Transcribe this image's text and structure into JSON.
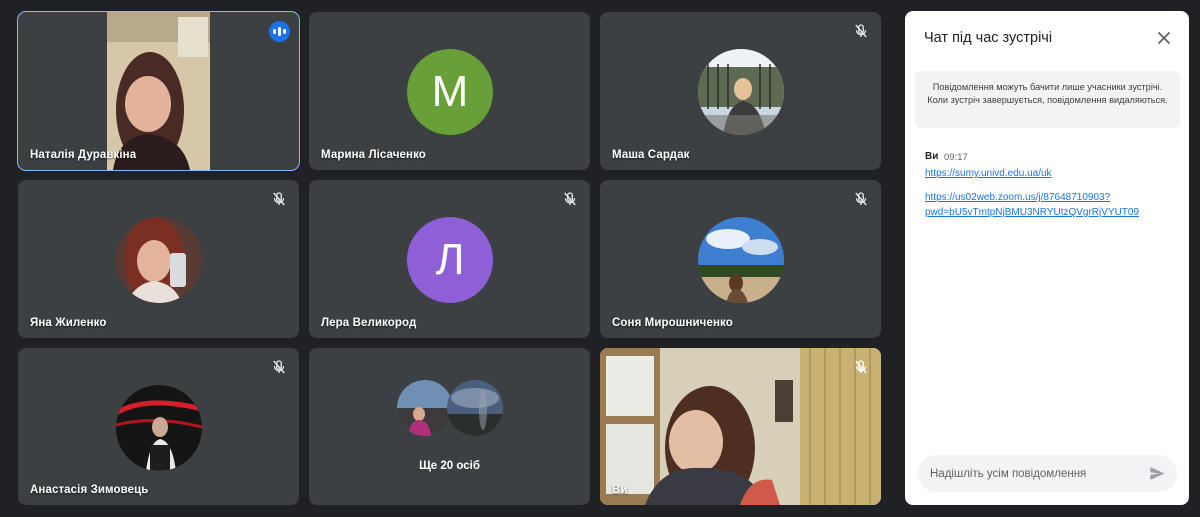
{
  "participants": [
    {
      "name": "Наталія Дуравкіна"
    },
    {
      "name": "Марина Лісаченко",
      "initial": "М",
      "color": "#689f38"
    },
    {
      "name": "Маша Сардак"
    },
    {
      "name": "Яна Жиленко"
    },
    {
      "name": "Лера Великород",
      "initial": "Л",
      "color": "#8e5fd6"
    },
    {
      "name": "Соня Мирошниченко"
    },
    {
      "name": "Анастасія Зимовець"
    },
    {
      "name": "Ще 20 осіб"
    },
    {
      "name": "Ви"
    }
  ],
  "chat": {
    "title": "Чат під час зустрічі",
    "notice": "Повідомлення можуть бачити лише учасники зустрічі. Коли зустріч завершується, повідомлення видаляються.",
    "message": {
      "sender": "Ви",
      "time": "09:17",
      "links": [
        "https://sumy.univd.edu.ua/uk",
        "https://us02web.zoom.us/j/87648710903?",
        "pwd=bU5vTmtpNjBMU3NRYUtzQVgrRjVYUT09"
      ]
    },
    "input_placeholder": "Надішліть усім повідомлення"
  },
  "colors": {
    "background": "#202124",
    "tile": "#3c4043",
    "active_border": "#8ab4f8",
    "link": "#1a73e8"
  }
}
